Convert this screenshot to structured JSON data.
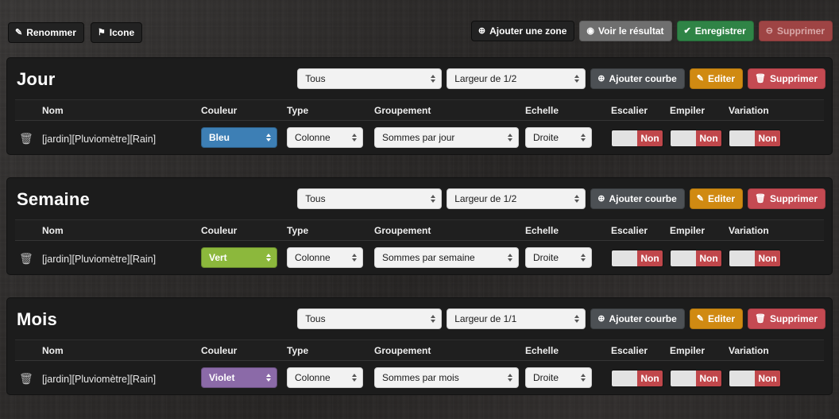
{
  "toolbar": {
    "left_buttons": [
      {
        "label": "Renommer",
        "icon": "pencil-icon",
        "glyph": "✎"
      },
      {
        "label": "Icone",
        "icon": "flag-icon",
        "glyph": "⚑"
      }
    ],
    "right_buttons": [
      {
        "label": "Ajouter une zone",
        "icon": "plus-circle-icon",
        "glyph": "⊕"
      },
      {
        "label": "Voir le résultat",
        "icon": "eye-icon",
        "glyph": "◉"
      },
      {
        "label": "Enregistrer",
        "icon": "check-circle-icon",
        "glyph": "✔"
      },
      {
        "label": "Supprimer",
        "icon": "minus-circle-icon",
        "glyph": "⊖"
      }
    ]
  },
  "panel_actions": {
    "add_curve_label": "Ajouter courbe",
    "add_curve_icon": "plus-circle-icon",
    "add_curve_glyph": "⊕",
    "edit_label": "Editer",
    "edit_icon": "pencil-icon",
    "edit_glyph": "✎",
    "delete_label": "Supprimer",
    "delete_icon": "trash-icon",
    "delete_glyph": "🗑"
  },
  "table_headers": {
    "nom": "Nom",
    "couleur": "Couleur",
    "type": "Type",
    "groupement": "Groupement",
    "echelle": "Echelle",
    "escalier": "Escalier",
    "empiler": "Empiler",
    "variation": "Variation"
  },
  "colors": {
    "bleu": "#3d7fb5",
    "vert": "#8cb83c",
    "violet": "#8b6aa8",
    "toggle_off": "#c0474b",
    "btn_green": "#2f8446",
    "btn_orange": "#d08a12",
    "btn_red": "#c44a52",
    "btn_grey": "#6f6f6f",
    "btn_slate": "#4c5054"
  },
  "panels": [
    {
      "title": "Jour",
      "filter_value": "Tous",
      "width_value": "Largeur de 1/2",
      "rows": [
        {
          "delete_icon": "trash-icon",
          "nom": "[jardin][Pluviomètre][Rain]",
          "couleur": "Bleu",
          "couleur_hex": "#3d7fb5",
          "type": "Colonne",
          "groupement": "Sommes par jour",
          "echelle": "Droite",
          "escalier": "Non",
          "empiler": "Non",
          "variation": "Non"
        }
      ]
    },
    {
      "title": "Semaine",
      "filter_value": "Tous",
      "width_value": "Largeur de 1/2",
      "rows": [
        {
          "delete_icon": "trash-icon",
          "nom": "[jardin][Pluviomètre][Rain]",
          "couleur": "Vert",
          "couleur_hex": "#8cb83c",
          "type": "Colonne",
          "groupement": "Sommes par semaine",
          "echelle": "Droite",
          "escalier": "Non",
          "empiler": "Non",
          "variation": "Non"
        }
      ]
    },
    {
      "title": "Mois",
      "filter_value": "Tous",
      "width_value": "Largeur de 1/1",
      "rows": [
        {
          "delete_icon": "trash-icon",
          "nom": "[jardin][Pluviomètre][Rain]",
          "couleur": "Violet",
          "couleur_hex": "#8b6aa8",
          "type": "Colonne",
          "groupement": "Sommes par mois",
          "echelle": "Droite",
          "escalier": "Non",
          "empiler": "Non",
          "variation": "Non"
        }
      ]
    }
  ]
}
